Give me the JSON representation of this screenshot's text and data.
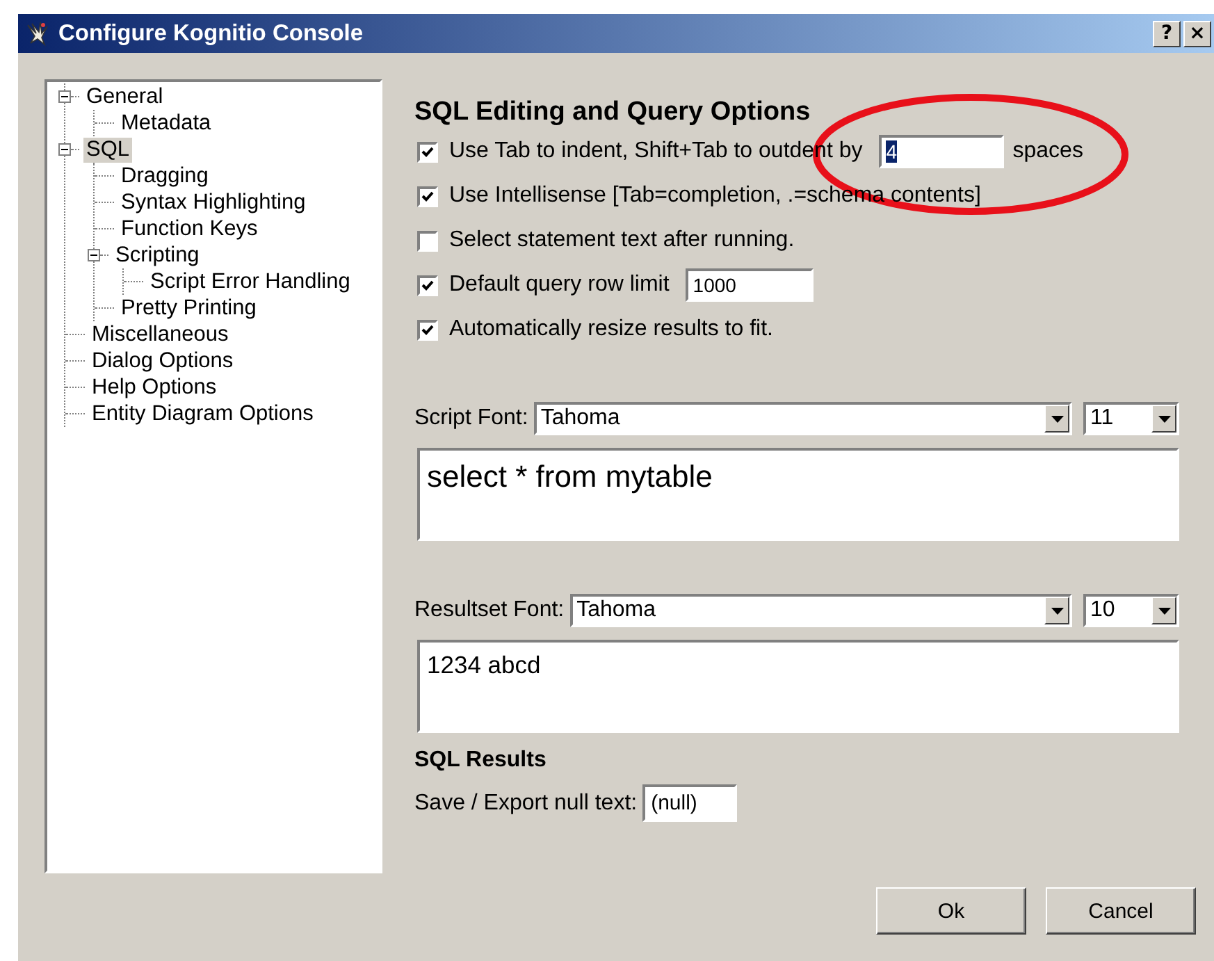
{
  "window": {
    "title": "Configure Kognitio Console",
    "help_button": "?",
    "close_button": "×"
  },
  "tree": [
    {
      "label": "General",
      "expanded": true,
      "selected": false,
      "children": [
        {
          "label": "Metadata",
          "selected": false
        }
      ]
    },
    {
      "label": "SQL",
      "expanded": true,
      "selected": true,
      "children": [
        {
          "label": "Dragging",
          "selected": false
        },
        {
          "label": "Syntax Highlighting",
          "selected": false
        },
        {
          "label": "Function Keys",
          "selected": false
        },
        {
          "label": "Scripting",
          "expanded": true,
          "selected": false,
          "children": [
            {
              "label": "Script Error Handling",
              "selected": false
            }
          ]
        },
        {
          "label": "Pretty Printing",
          "selected": false
        }
      ]
    },
    {
      "label": "Miscellaneous",
      "selected": false
    },
    {
      "label": "Dialog Options",
      "selected": false
    },
    {
      "label": "Help Options",
      "selected": false
    },
    {
      "label": "Entity Diagram Options",
      "selected": false
    }
  ],
  "section_title": "SQL Editing and Query Options",
  "options": [
    {
      "label": "Use Tab to indent, Shift+Tab to outdent by",
      "checked": true,
      "input": {
        "value": "4",
        "text_selected": true
      },
      "suffix": "spaces"
    },
    {
      "label": "Use Intellisense [Tab=completion, .=schema contents]",
      "checked": true
    },
    {
      "label": "Select statement text after running.",
      "checked": false
    },
    {
      "label": "Default query row limit",
      "checked": true,
      "input": {
        "value": "1000",
        "text_selected": false
      }
    },
    {
      "label": "Automatically resize results to fit.",
      "checked": true
    }
  ],
  "fonts": [
    {
      "label": "Script Font:",
      "font": "Tahoma",
      "size": "11",
      "preview": "select * from mytable",
      "kind": "script"
    },
    {
      "label": "Resultset Font:",
      "font": "Tahoma",
      "size": "10",
      "preview": "1234 abcd",
      "kind": "resultset"
    }
  ],
  "sql_results": {
    "title": "SQL Results",
    "null_text_label": "Save / Export null text:",
    "null_text": "(null)"
  },
  "buttons": [
    "Ok",
    "Cancel"
  ],
  "annotations": [
    {
      "kind": "ellipse"
    }
  ]
}
